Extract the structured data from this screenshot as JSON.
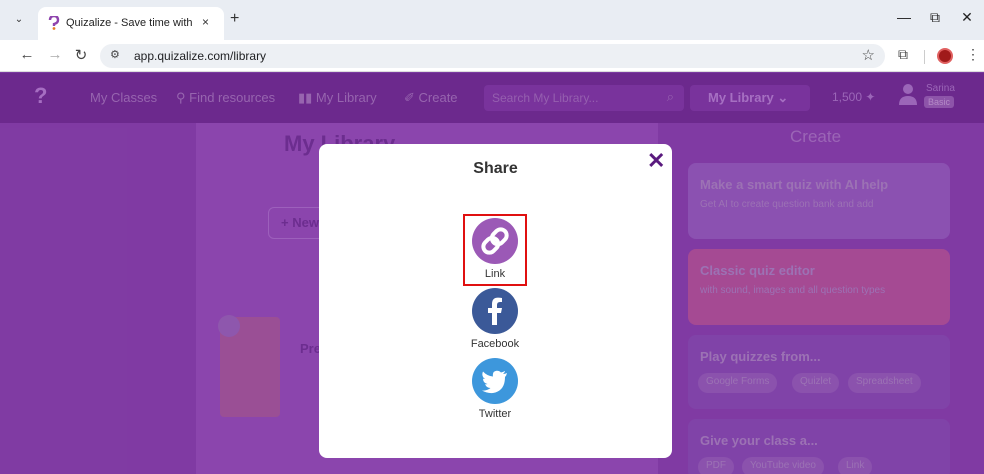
{
  "browser": {
    "tab_title": "Quizalize - Save time with pers",
    "tab_close": "×",
    "new_tab": "+",
    "tab_menu": "⌄",
    "url": "app.quizalize.com/library",
    "controls": {
      "minimize": "—",
      "restore": "⧉",
      "close": "✕"
    }
  },
  "nav": {
    "links": [
      "My Classes",
      "Find resources",
      "My Library",
      "Create"
    ],
    "search_placeholder": "Search My Library...",
    "library_select": "My Library ⌄",
    "points": "1,500",
    "user_name": "Sarina",
    "plan": "Basic"
  },
  "library": {
    "title": "My Library",
    "new_button": "+ New",
    "card_title": "Pre"
  },
  "create_panel": {
    "title": "Create",
    "cards": [
      {
        "title": "Make a smart quiz with AI help",
        "subtitle": "Get AI to create question bank and add",
        "color": "#8a5cb6"
      },
      {
        "title": "Classic quiz editor",
        "subtitle": "with sound, images and all question types",
        "color": "#b25287"
      },
      {
        "title": "Play quizzes from...",
        "chips": [
          "Google Forms",
          "Quizlet",
          "Spreadsheet"
        ],
        "color": "#7a48a8"
      },
      {
        "title": "Give your class a...",
        "chips": [
          "PDF",
          "YouTube video",
          "Link"
        ],
        "color": "#7a48a8"
      }
    ]
  },
  "modal": {
    "title": "Share",
    "close": "✕",
    "options": [
      {
        "label": "Link",
        "icon": "link-icon",
        "color": "#9b59b6"
      },
      {
        "label": "Facebook",
        "icon": "facebook-icon",
        "color": "#3b5998"
      },
      {
        "label": "Twitter",
        "icon": "twitter-icon",
        "color": "#3d97dc"
      }
    ]
  }
}
